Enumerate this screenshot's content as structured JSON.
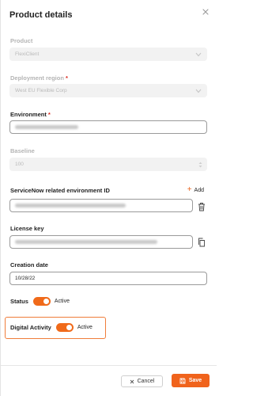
{
  "header": {
    "title": "Product details"
  },
  "fields": {
    "product": {
      "label": "Product",
      "value": "FlexiClient"
    },
    "deployment_region": {
      "label": "Deployment region",
      "required_mark": "*",
      "value": "West EU Flexible Corp"
    },
    "environment": {
      "label": "Environment",
      "required_mark": "*"
    },
    "baseline": {
      "label": "Baseline",
      "value": "100"
    },
    "servicenow_id": {
      "label": "ServiceNow related environment ID",
      "add_label": "Add"
    },
    "license_key": {
      "label": "License key"
    },
    "creation_date": {
      "label": "Creation date",
      "value": "10/28/22"
    }
  },
  "toggles": {
    "status": {
      "label": "Status",
      "state": "Active",
      "on": true
    },
    "digital_activity": {
      "label": "Digital Activity",
      "state": "Active",
      "on": true
    }
  },
  "footer": {
    "cancel_label": "Cancel",
    "save_label": "Save"
  },
  "colors": {
    "accent": "#f0631c",
    "required": "#d9261c"
  },
  "icons": {
    "close": "close-icon",
    "add": "plus-icon",
    "delete": "trash-icon",
    "copy": "copy-icon",
    "cancel": "x-icon",
    "save": "save-icon"
  }
}
